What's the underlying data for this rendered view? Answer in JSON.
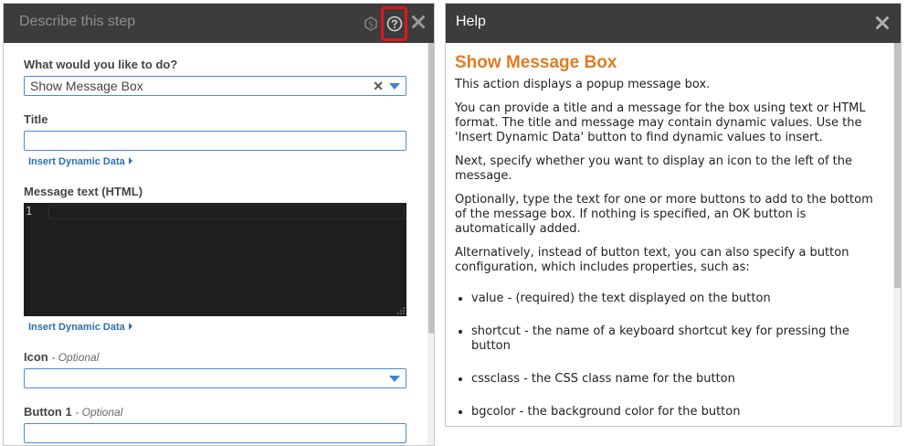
{
  "left_panel": {
    "title": "Describe this step",
    "action_label": "What would you like to do?",
    "action_value": "Show Message Box",
    "title_label": "Title",
    "title_value": "",
    "insert_dynamic_data_1": "Insert Dynamic Data",
    "message_label": "Message text (HTML)",
    "message_line_number": "1",
    "insert_dynamic_data_2": "Insert Dynamic Data",
    "icon_label": "Icon",
    "icon_optional": "- Optional",
    "icon_value": "",
    "button1_label": "Button 1",
    "button1_optional": "- Optional",
    "button1_value": ""
  },
  "help_panel": {
    "title": "Help",
    "heading": "Show Message Box",
    "paragraphs": [
      "This action displays a popup message box.",
      "You can provide a title and a message for the box using text or HTML format. The title and message may contain dynamic values. Use the 'Insert Dynamic Data' button to find dynamic values to insert.",
      "Next, specify whether you want to display an icon to the left of the message.",
      "Optionally, type the text for one or more buttons to add to the bottom of the message box. If nothing is specified, an OK button is automatically added.",
      "Alternatively, instead of button text, you can also specify a button configuration, which includes properties, such as:"
    ],
    "bullets": [
      "value - (required) the text displayed on the button",
      "shortcut - the name of a keyboard shortcut key for pressing the button",
      "cssclass - the CSS class name for the button",
      "bgcolor - the background color for the button"
    ]
  },
  "icons": {
    "script": "script-icon",
    "help": "help-circle-icon",
    "close": "close-icon",
    "dropdown": "chevron-down-icon"
  },
  "colors": {
    "header_bg": "#3c3c3c",
    "accent_blue": "#3a87cf",
    "highlight_red": "#e3151c",
    "heading_orange": "#e07b22"
  }
}
